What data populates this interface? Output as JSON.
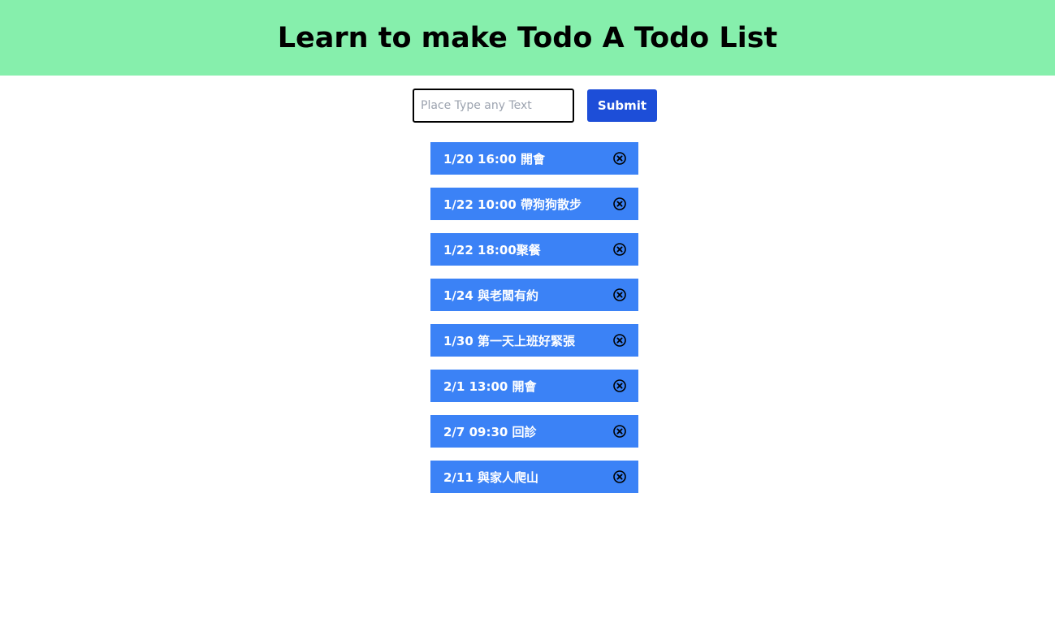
{
  "header": {
    "title": "Learn to make Todo A Todo List"
  },
  "form": {
    "placeholder": "Place Type any Text",
    "value": "",
    "submit_label": "Submit"
  },
  "todos": [
    {
      "text": "1/20 16:00 開會",
      "delete_icon": "close-circle-icon"
    },
    {
      "text": "1/22 10:00 帶狗狗散步",
      "delete_icon": "close-circle-icon"
    },
    {
      "text": "1/22 18:00聚餐",
      "delete_icon": "close-circle-icon"
    },
    {
      "text": "1/24 與老闆有約",
      "delete_icon": "close-circle-icon"
    },
    {
      "text": "1/30 第一天上班好緊張",
      "delete_icon": "close-circle-icon"
    },
    {
      "text": "2/1 13:00 開會",
      "delete_icon": "close-circle-icon"
    },
    {
      "text": "2/7 09:30 回診",
      "delete_icon": "close-circle-icon"
    },
    {
      "text": "2/11 與家人爬山",
      "delete_icon": "close-circle-icon"
    }
  ],
  "colors": {
    "header_bg": "#86efac",
    "submit_bg": "#1d4ed8",
    "item_bg": "#3b82f6"
  }
}
